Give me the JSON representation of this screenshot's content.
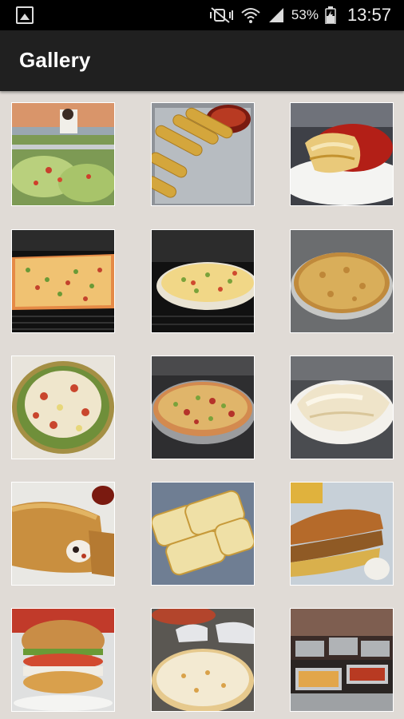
{
  "status_bar": {
    "battery_percent": "53%",
    "time": "13:57",
    "icons": [
      "gallery-icon",
      "mute-icon",
      "wifi-icon",
      "signal-icon",
      "battery-icon"
    ]
  },
  "app_bar": {
    "title": "Gallery"
  },
  "gallery": {
    "items": [
      {
        "name": "salad-bar-photo"
      },
      {
        "name": "breadsticks-photo"
      },
      {
        "name": "lasagna-photo"
      },
      {
        "name": "square-pizza-oven-photo"
      },
      {
        "name": "pizza-oven-photo"
      },
      {
        "name": "cheese-pizza-photo"
      },
      {
        "name": "greek-salad-photo"
      },
      {
        "name": "supreme-pizza-photo"
      },
      {
        "name": "pasta-alfredo-photo"
      },
      {
        "name": "calzone-photo"
      },
      {
        "name": "garlic-bread-photo"
      },
      {
        "name": "sub-sandwich-photo"
      },
      {
        "name": "burger-photo"
      },
      {
        "name": "pizza-prep-photo"
      },
      {
        "name": "buffet-photo"
      }
    ]
  }
}
